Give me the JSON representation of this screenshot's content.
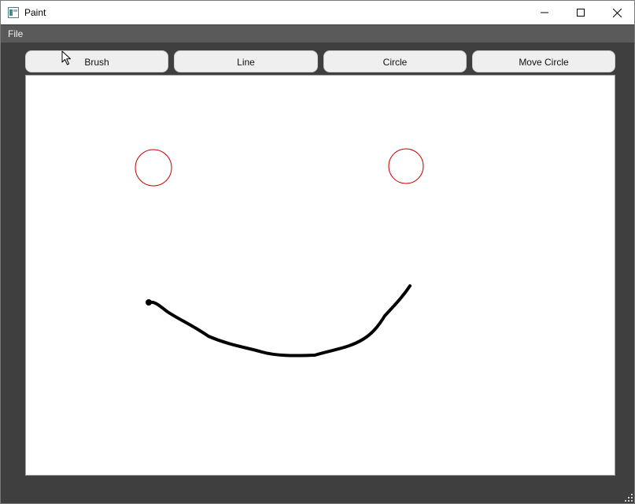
{
  "window": {
    "title": "Paint",
    "icons": {
      "app": "paint-app-icon",
      "minimize": "minimize-icon",
      "maximize": "maximize-icon",
      "close": "close-icon",
      "cursor": "mouse-cursor-icon",
      "resize_grip": "resize-grip-icon"
    }
  },
  "menu": {
    "file_label": "File"
  },
  "toolbar": {
    "brush_label": "Brush",
    "line_label": "Line",
    "circle_label": "Circle",
    "move_circle_label": "Move Circle"
  },
  "colors": {
    "window_bg": "#3f3f3f",
    "menubar_bg": "#5a5a5a",
    "button_bg": "#efefef",
    "circle_stroke": "#cc0000",
    "brush_stroke": "#000000"
  }
}
